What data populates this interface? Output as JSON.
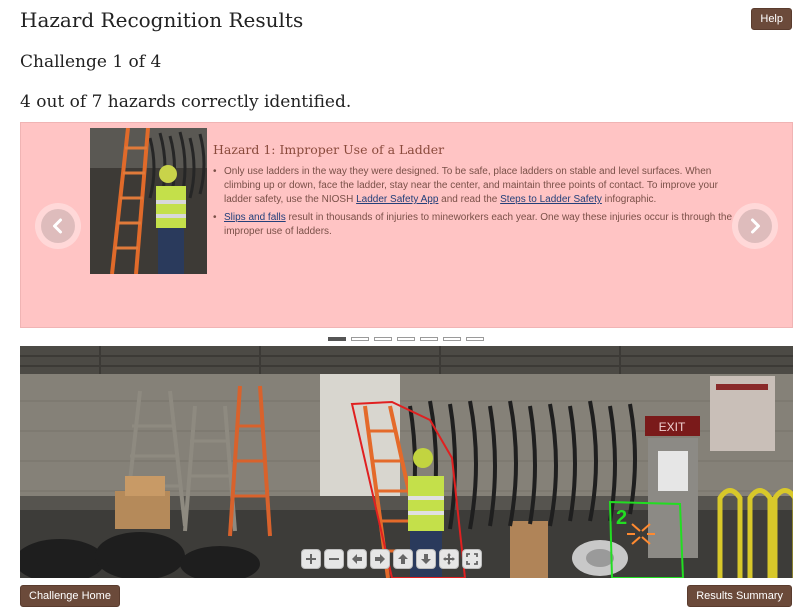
{
  "header": {
    "title": "Hazard Recognition Results",
    "help_label": "Help",
    "challenge": "Challenge 1 of 4",
    "score": "4 out of 7 hazards correctly identified."
  },
  "hazard": {
    "title": "Hazard 1: Improper Use of a Ladder",
    "bullet1_text": "Only use ladders in the way they were designed. To be safe, place ladders on stable and level surfaces. When climbing up or down, face the ladder, stay near the center, and maintain three points of contact. To improve your ladder safety, use the NIOSH ",
    "bullet1_link1": "Ladder Safety App",
    "bullet1_mid": " and read the ",
    "bullet1_link2": "Steps to Ladder Safety",
    "bullet1_end": " infographic.",
    "bullet2_link": "Slips and falls",
    "bullet2_text": " result in thousands of injuries to mineworkers each year. One way these injuries occur is through the improper use of ladders."
  },
  "carousel": {
    "slide_count": 7,
    "active_index": 0
  },
  "scene": {
    "exit_sign": "EXIT",
    "marker_2": "2",
    "highlight_colors": {
      "ladder": "#e02020",
      "marker": "#22dd22"
    }
  },
  "viewer_tools": [
    "zoom-in-icon",
    "zoom-out-icon",
    "pan-left-icon",
    "pan-right-icon",
    "pan-up-icon",
    "pan-down-icon",
    "move-icon",
    "fullscreen-icon"
  ],
  "footer": {
    "home_label": "Challenge Home",
    "summary_label": "Results Summary"
  }
}
